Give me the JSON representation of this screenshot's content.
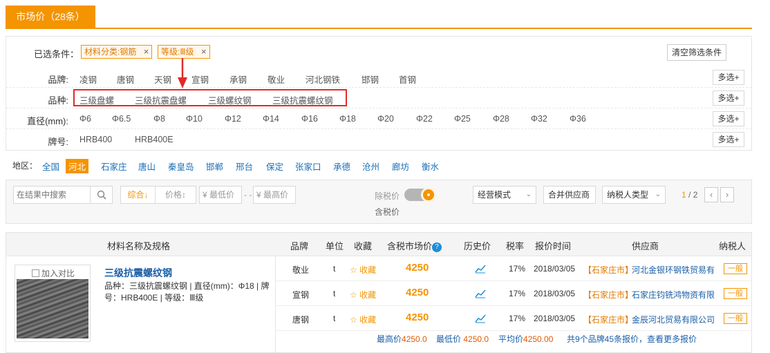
{
  "tab": {
    "label": "市场价（28条）"
  },
  "selected": {
    "label": "已选条件：",
    "tags": [
      "材料分类:钢筋",
      "等级:Ⅲ级"
    ],
    "remove_glyph": "×",
    "clear_label": "清空筛选条件"
  },
  "filters": [
    {
      "label": "品牌:",
      "options": [
        "凌钢",
        "唐钢",
        "天钢",
        "宣钢",
        "承钢",
        "敬业",
        "河北钢铁",
        "邯钢",
        "首钢"
      ],
      "more": "多选+"
    },
    {
      "label": "品种:",
      "options": [
        "三级盘螺",
        "三级抗震盘螺",
        "三级螺纹钢",
        "三级抗震螺纹钢"
      ],
      "more": "多选+"
    },
    {
      "label": "直径(mm):",
      "options": [
        "Φ6",
        "Φ6.5",
        "Φ8",
        "Φ10",
        "Φ12",
        "Φ14",
        "Φ16",
        "Φ18",
        "Φ20",
        "Φ22",
        "Φ25",
        "Φ28",
        "Φ32",
        "Φ36"
      ],
      "more": "多选+"
    },
    {
      "label": "牌号:",
      "options": [
        "HRB400",
        "HRB400E"
      ],
      "more": "多选+"
    }
  ],
  "region": {
    "label": "地区：",
    "items": [
      "全国",
      "河北",
      "石家庄",
      "唐山",
      "秦皇岛",
      "邯郸",
      "邢台",
      "保定",
      "张家口",
      "承德",
      "沧州",
      "廊坊",
      "衡水"
    ],
    "active": "河北"
  },
  "toolbar": {
    "search_placeholder": "在结果中搜索",
    "sort_default": "综合↓",
    "sort_price": "价格↕",
    "min_price": "¥ 最低价",
    "max_price": "¥ 最高价",
    "dash": "- -",
    "tax_excluded": "除税价",
    "tax_included": "含税价",
    "mode_select": "经营模式",
    "merge_btn": "合并供应商",
    "taxpayer_select": "纳税人类型",
    "page_current": "1",
    "page_total": "/ 2"
  },
  "table": {
    "headers": [
      "材料名称及规格",
      "品牌",
      "单位",
      "收藏",
      "含税市场价",
      "历史价",
      "税率",
      "报价时间",
      "供应商",
      "纳税人"
    ],
    "product": {
      "compare": "加入对比",
      "title": "三级抗震螺纹钢",
      "desc": "品种：三级抗震螺纹钢 | 直径(mm)：Φ18 | 牌号：HRB400E | 等级：Ⅲ级"
    },
    "rows": [
      {
        "brand": "敬业",
        "unit": "t",
        "fav": "☆ 收藏",
        "price": "4250",
        "tax": "17%",
        "date": "2018/03/05",
        "region": "【石家庄市】",
        "supplier": "河北金银环钢铁贸易有",
        "badge": "一般"
      },
      {
        "brand": "宣钢",
        "unit": "t",
        "fav": "☆ 收藏",
        "price": "4250",
        "tax": "17%",
        "date": "2018/03/05",
        "region": "【石家庄市】",
        "supplier": "石家庄钧铣鸿物资有限",
        "badge": "一般"
      },
      {
        "brand": "唐钢",
        "unit": "t",
        "fav": "☆ 收藏",
        "price": "4250",
        "tax": "17%",
        "date": "2018/03/05",
        "region": "【石家庄市】",
        "supplier": "金辰河北贸易有限公司",
        "badge": "一般"
      }
    ],
    "summary": {
      "max_label": "最高价",
      "max": "4250.0",
      "min_label": "最低价",
      "min": "4250.0",
      "avg_label": "平均价",
      "avg": "4250.00",
      "more": "共9个品牌45条报价，查看更多报价"
    }
  }
}
